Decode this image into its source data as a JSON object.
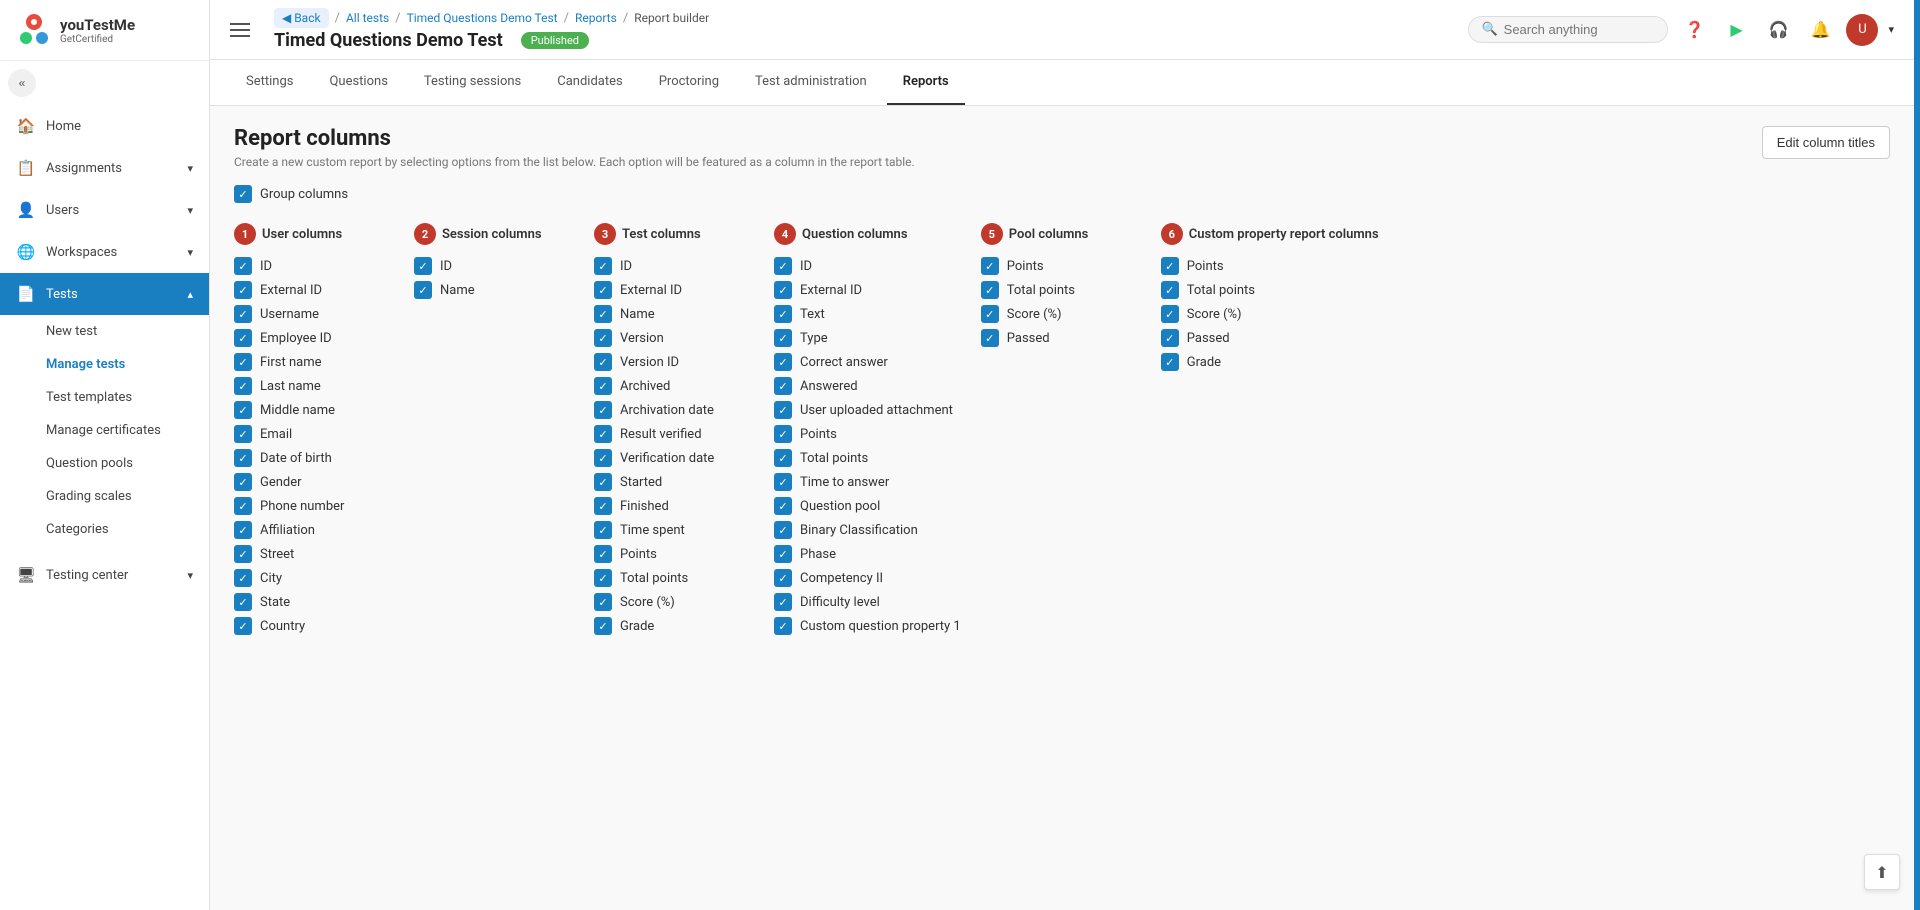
{
  "app": {
    "name": "youTestMe",
    "sub": "GetCertified"
  },
  "sidebar": {
    "collapse_icon": "«",
    "items": [
      {
        "id": "home",
        "label": "Home",
        "icon": "🏠",
        "arrow": ""
      },
      {
        "id": "assignments",
        "label": "Assignments",
        "icon": "📋",
        "arrow": "▾"
      },
      {
        "id": "users",
        "label": "Users",
        "icon": "👤",
        "arrow": "▾"
      },
      {
        "id": "workspaces",
        "label": "Workspaces",
        "icon": "🌐",
        "arrow": "▾"
      },
      {
        "id": "tests",
        "label": "Tests",
        "icon": "📄",
        "arrow": "▴",
        "active": true
      }
    ],
    "sub_items": [
      {
        "id": "new-test",
        "label": "New test"
      },
      {
        "id": "manage-tests",
        "label": "Manage tests",
        "active": true
      },
      {
        "id": "test-templates",
        "label": "Test templates"
      },
      {
        "id": "manage-certificates",
        "label": "Manage certificates"
      },
      {
        "id": "question-pools",
        "label": "Question pools"
      },
      {
        "id": "grading-scales",
        "label": "Grading scales"
      },
      {
        "id": "categories",
        "label": "Categories"
      }
    ],
    "bottom_items": [
      {
        "id": "testing-center",
        "label": "Testing center",
        "icon": "🖥",
        "arrow": "▾"
      }
    ]
  },
  "topbar": {
    "breadcrumb": {
      "back_label": "◀ Back",
      "all_tests": "All tests",
      "test_name": "Timed Questions Demo Test",
      "reports": "Reports",
      "builder": "Report builder"
    },
    "test_title": "Timed Questions Demo Test",
    "badge": "Published",
    "search_placeholder": "Search anything"
  },
  "tabs": [
    {
      "id": "settings",
      "label": "Settings"
    },
    {
      "id": "questions",
      "label": "Questions"
    },
    {
      "id": "testing-sessions",
      "label": "Testing sessions"
    },
    {
      "id": "candidates",
      "label": "Candidates"
    },
    {
      "id": "proctoring",
      "label": "Proctoring"
    },
    {
      "id": "test-administration",
      "label": "Test administration"
    },
    {
      "id": "reports",
      "label": "Reports",
      "active": true
    }
  ],
  "report_columns": {
    "title": "Report columns",
    "description": "Create a new custom report by selecting options from the list below. Each option will be featured as a column in the report table.",
    "edit_button": "Edit column titles",
    "group_columns_label": "Group columns",
    "sections": [
      {
        "id": 1,
        "badge": "1",
        "title": "User columns",
        "items": [
          "ID",
          "External ID",
          "Username",
          "Employee ID",
          "First name",
          "Last name",
          "Middle name",
          "Email",
          "Date of birth",
          "Gender",
          "Phone number",
          "Affiliation",
          "Street",
          "City",
          "State",
          "Country"
        ]
      },
      {
        "id": 2,
        "badge": "2",
        "title": "Session columns",
        "items": [
          "ID",
          "Name"
        ]
      },
      {
        "id": 3,
        "badge": "3",
        "title": "Test columns",
        "items": [
          "ID",
          "External ID",
          "Name",
          "Version",
          "Version ID",
          "Archived",
          "Archivation date",
          "Result verified",
          "Verification date",
          "Started",
          "Finished",
          "Time spent",
          "Points",
          "Total points",
          "Score (%)",
          "Grade"
        ]
      },
      {
        "id": 4,
        "badge": "4",
        "title": "Question columns",
        "items": [
          "ID",
          "External ID",
          "Text",
          "Type",
          "Correct answer",
          "Answered",
          "User uploaded attachment",
          "Points",
          "Total points",
          "Time to answer",
          "Question pool",
          "Binary Classification",
          "Phase",
          "Competency II",
          "Difficulty level",
          "Custom question property 1"
        ]
      },
      {
        "id": 5,
        "badge": "5",
        "title": "Pool columns",
        "items": [
          "Points",
          "Total points",
          "Score (%)",
          "Passed"
        ]
      },
      {
        "id": 6,
        "badge": "6",
        "title": "Custom property report columns",
        "items": [
          "Points",
          "Total points",
          "Score (%)",
          "Passed",
          "Grade"
        ]
      }
    ]
  }
}
